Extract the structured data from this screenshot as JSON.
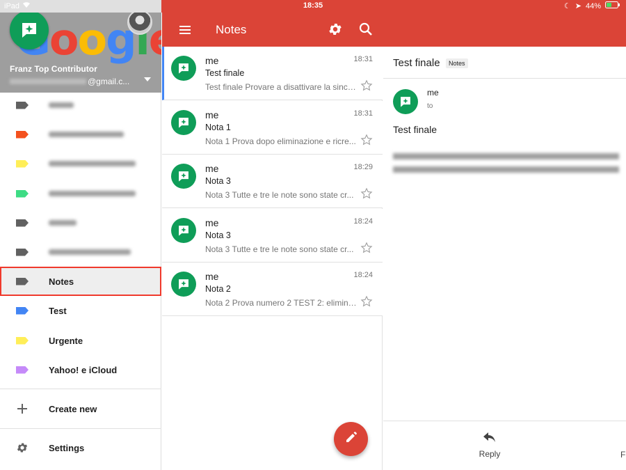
{
  "status": {
    "device": "iPad",
    "time": "18:35",
    "battery": "44%"
  },
  "drawer": {
    "account_name": "Franz Top Contributor",
    "account_email_suffix": "@gmail.c...",
    "labels": [
      {
        "label": "",
        "color": "#616161",
        "blurred": true
      },
      {
        "label": "",
        "color": "#f4511e",
        "blurred": true
      },
      {
        "label": "",
        "color": "#ffee58",
        "blurred": true
      },
      {
        "label": "",
        "color": "#3ddc84",
        "blurred": true
      },
      {
        "label": "",
        "color": "#616161",
        "blurred": true
      },
      {
        "label": "",
        "color": "#616161",
        "blurred": true
      },
      {
        "label": "Notes",
        "color": "#616161",
        "selected": true
      },
      {
        "label": "Test",
        "color": "#4285f4"
      },
      {
        "label": "Urgente",
        "color": "#ffee58"
      },
      {
        "label": "Yahoo! e iCloud",
        "color": "#c58af9"
      }
    ],
    "create_new": "Create new",
    "settings": "Settings"
  },
  "toolbar": {
    "title": "Notes"
  },
  "messages": [
    {
      "sender": "me",
      "time": "18:31",
      "subject": "Test finale",
      "snippet": "Test finale Provare a disattivare la sincr...",
      "active": true
    },
    {
      "sender": "me",
      "time": "18:31",
      "subject": "Nota 1",
      "snippet": "Nota 1 Prova dopo eliminazione e ricre..."
    },
    {
      "sender": "me",
      "time": "18:29",
      "subject": "Nota 3",
      "snippet": "Nota 3 Tutte e tre le note sono state cr..."
    },
    {
      "sender": "me",
      "time": "18:24",
      "subject": "Nota 3",
      "snippet": "Nota 3 Tutte e tre le note sono state cr..."
    },
    {
      "sender": "me",
      "time": "18:24",
      "subject": "Nota 2",
      "snippet": "Nota 2 Prova numero 2 TEST 2: elimina..."
    }
  ],
  "detail": {
    "subject": "Test finale",
    "label_chip": "Notes",
    "sender": "me",
    "to": "to",
    "body_title": "Test finale",
    "reply_label": "Reply",
    "forward_label_cut": "F"
  },
  "colors": {
    "brand_red": "#db4437",
    "notes_green": "#0f9d58",
    "selection_outline": "#f0392c"
  }
}
